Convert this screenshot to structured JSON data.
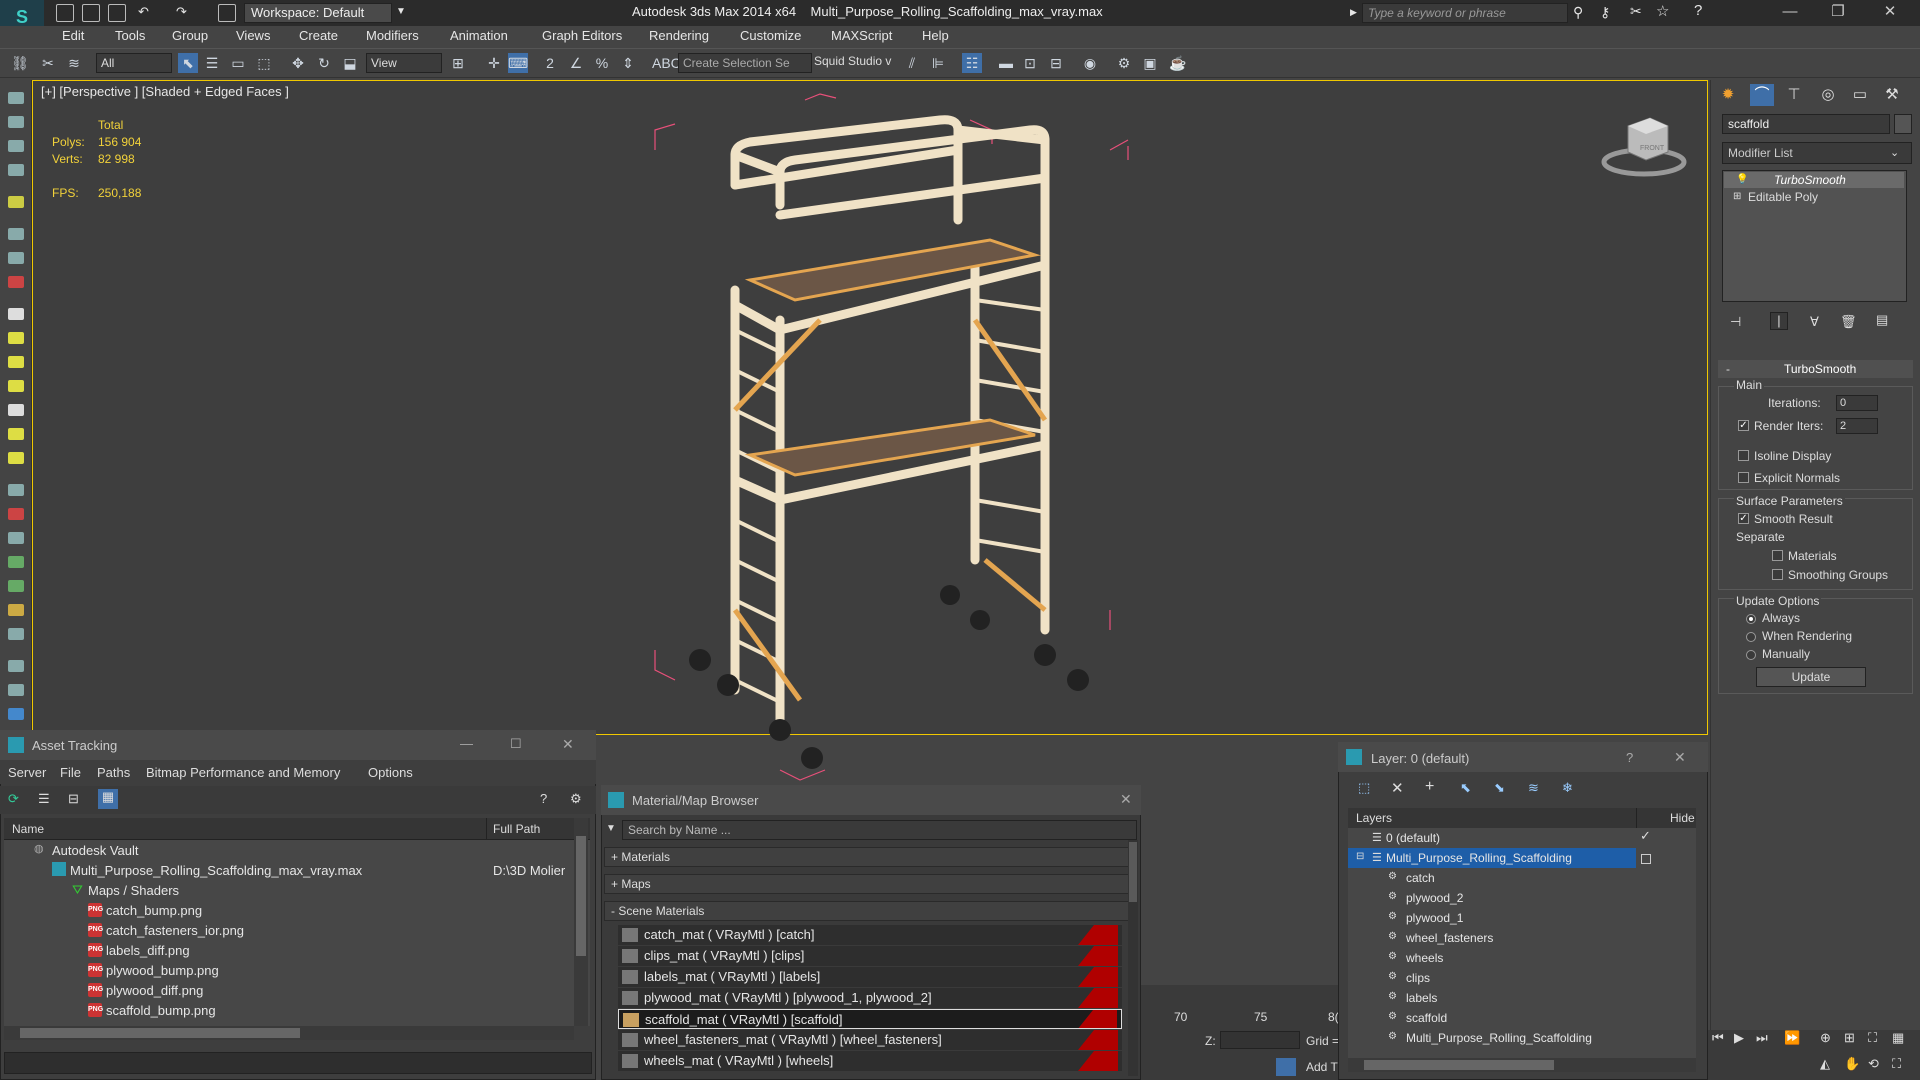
{
  "window": {
    "workspace": "Workspace: Default",
    "app_name": "Autodesk 3ds Max  2014 x64",
    "file_name": "Multi_Purpose_Rolling_Scaffolding_max_vray.max",
    "search_placeholder": "Type a keyword or phrase"
  },
  "menu": [
    "Edit",
    "Tools",
    "Group",
    "Views",
    "Create",
    "Modifiers",
    "Animation",
    "Graph Editors",
    "Rendering",
    "Customize",
    "MAXScript",
    "Help"
  ],
  "toolbar": {
    "filter": "All",
    "ref_coord": "View",
    "selection_set": "Create Selection Se",
    "plugin_label": "Squid Studio v"
  },
  "viewport": {
    "label": "[+] [Perspective ] [Shaded + Edged Faces ]",
    "stats": {
      "total_label": "Total",
      "polys_label": "Polys:",
      "polys_value": "156 904",
      "verts_label": "Verts:",
      "verts_value": "82 998",
      "fps_label": "FPS:",
      "fps_value": "250,188"
    },
    "viewcube_label": "FRONT",
    "colors": {
      "scaffold": "#f0e2c6",
      "selection_box": "#e8507a",
      "platform": "#6b5646"
    }
  },
  "command_panel": {
    "object_name": "scaffold",
    "modifier_list": "Modifier List",
    "stack": [
      "TurboSmooth",
      "Editable Poly"
    ],
    "rollout_title": "TurboSmooth",
    "main_label": "Main",
    "iterations_label": "Iterations:",
    "iterations_value": "0",
    "render_iters_label": "Render Iters:",
    "render_iters_value": "2",
    "isoline_label": "Isoline Display",
    "explicit_normals_label": "Explicit Normals",
    "surface_params_label": "Surface Parameters",
    "smooth_result_label": "Smooth Result",
    "separate_label": "Separate",
    "materials_label": "Materials",
    "smoothing_groups_label": "Smoothing Groups",
    "update_options_label": "Update Options",
    "always_label": "Always",
    "when_rendering_label": "When Rendering",
    "manually_label": "Manually",
    "update_button": "Update"
  },
  "asset_tracking": {
    "title": "Asset Tracking",
    "menu": [
      "Server",
      "File",
      "Paths",
      "Bitmap Performance and Memory",
      "Options"
    ],
    "col_name": "Name",
    "col_path": "Full Path",
    "vault": "Autodesk Vault",
    "max_file": "Multi_Purpose_Rolling_Scaffolding_max_vray.max",
    "max_file_path": "D:\\3D Molier",
    "maps_folder": "Maps / Shaders",
    "files": [
      "catch_bump.png",
      "catch_fasteners_ior.png",
      "labels_diff.png",
      "plywood_bump.png",
      "plywood_diff.png",
      "scaffold_bump.png"
    ],
    "png_badge": "PNG"
  },
  "material_browser": {
    "title": "Material/Map Browser",
    "search_placeholder": "Search by Name ...",
    "groups": [
      "+ Materials",
      "+ Maps",
      "- Scene Materials"
    ],
    "materials": [
      "catch_mat  ( VRayMtl )  [catch]",
      "clips_mat  ( VRayMtl )  [clips]",
      "labels_mat  ( VRayMtl )  [labels]",
      "plywood_mat  ( VRayMtl )  [plywood_1, plywood_2]",
      "scaffold_mat  ( VRayMtl )  [scaffold]",
      "wheel_fasteners_mat  ( VRayMtl )  [wheel_fasteners]",
      "wheels_mat  ( VRayMtl )  [wheels]"
    ]
  },
  "layer_window": {
    "title": "Layer: 0 (default)",
    "col_layers": "Layers",
    "col_hide": "Hide",
    "rows": [
      "0 (default)",
      "Multi_Purpose_Rolling_Scaffolding",
      "catch",
      "plywood_2",
      "plywood_1",
      "wheel_fasteners",
      "wheels",
      "clips",
      "labels",
      "scaffold",
      "Multi_Purpose_Rolling_Scaffolding"
    ]
  },
  "timeline": {
    "ticks": [
      "70",
      "75",
      "8("
    ],
    "z_label": "Z:",
    "grid_label": "Grid =",
    "add_label": "Add T"
  }
}
